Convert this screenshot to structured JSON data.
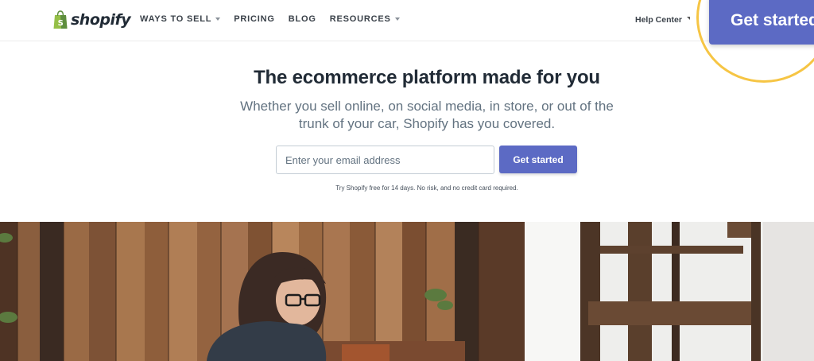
{
  "header": {
    "logo_text": "shopify",
    "nav": [
      {
        "label": "WAYS TO SELL",
        "has_dropdown": true
      },
      {
        "label": "PRICING",
        "has_dropdown": false
      },
      {
        "label": "BLOG",
        "has_dropdown": false
      },
      {
        "label": "RESOURCES",
        "has_dropdown": true
      }
    ],
    "help_label": "Help Center",
    "cta_label": "Get started"
  },
  "hero": {
    "title": "The ecommerce platform made for you",
    "subtitle": "Whether you sell online, on social media, in store, or out of the trunk of your car, Shopify has you covered.",
    "email_placeholder": "Enter your email address",
    "cta_label": "Get started",
    "trial_note": "Try Shopify free for 14 days. No risk, and no credit card required."
  },
  "colors": {
    "accent": "#5c6ac4",
    "logo_green": "#95bf47",
    "highlight": "#f6c544"
  }
}
